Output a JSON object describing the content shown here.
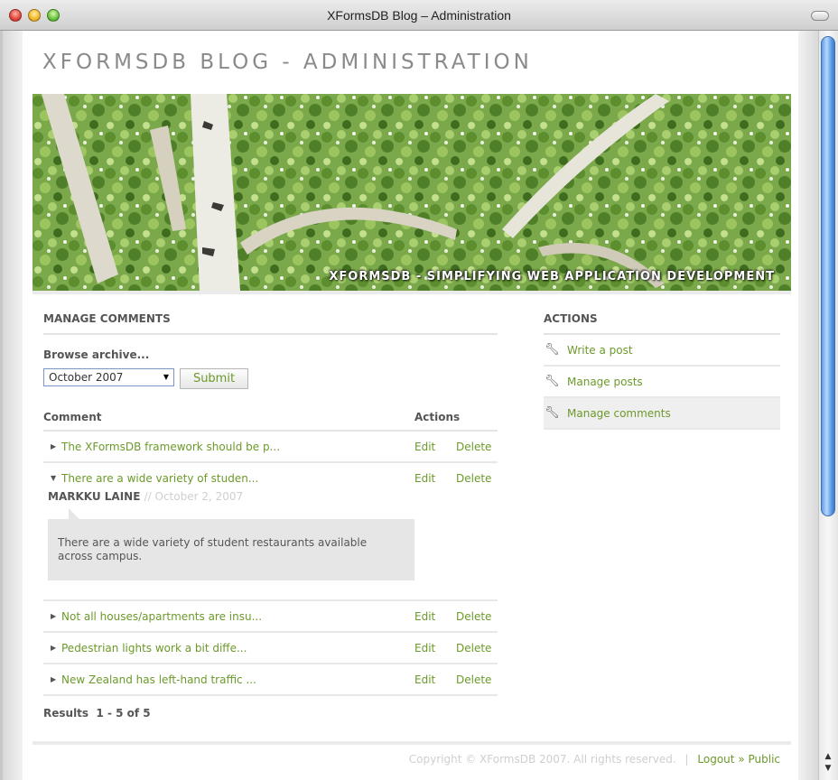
{
  "window": {
    "title": "XFormsDB Blog – Administration"
  },
  "site": {
    "title": "XFORMSDB BLOG - ADMINISTRATION"
  },
  "banner": {
    "caption": "XFORMSDB - SIMPLIFYING WEB APPLICATION DEVELOPMENT"
  },
  "manage": {
    "heading": "MANAGE COMMENTS",
    "browse_label": "Browse archive...",
    "archive_selected": "October 2007",
    "submit_label": "Submit",
    "col_comment": "Comment",
    "col_actions": "Actions",
    "edit_label": "Edit",
    "delete_label": "Delete",
    "rows": [
      {
        "text": "The XFormsDB framework should be p...",
        "expanded": false
      },
      {
        "text": "There are a wide variety of studen...",
        "expanded": true,
        "author": "MARKKU LAINE",
        "date": "// October 2, 2007",
        "body": "There are a wide variety of student restaurants available across campus."
      },
      {
        "text": "Not all houses/apartments are insu...",
        "expanded": false
      },
      {
        "text": "Pedestrian lights work a bit diffe...",
        "expanded": false
      },
      {
        "text": "New Zealand has left-hand traffic ...",
        "expanded": false
      }
    ],
    "results_label": "Results",
    "results_range": "1 - 5 of 5"
  },
  "sidebar": {
    "heading": "ACTIONS",
    "items": [
      {
        "label": "Write a post",
        "icon": "wrench-icon",
        "active": false
      },
      {
        "label": "Manage posts",
        "icon": "wrench-icon",
        "active": false
      },
      {
        "label": "Manage comments",
        "icon": "wrench-icon",
        "active": true
      }
    ]
  },
  "footer": {
    "copyright": "Copyright © XFormsDB 2007. All rights reserved.",
    "separator": "|",
    "logout": "Logout",
    "raquo": "»",
    "public": "Public"
  },
  "colors": {
    "link": "#6c9a2a",
    "muted": "#cfcfcf",
    "heading": "#555555",
    "scrollbar": "#5f9ee8"
  }
}
